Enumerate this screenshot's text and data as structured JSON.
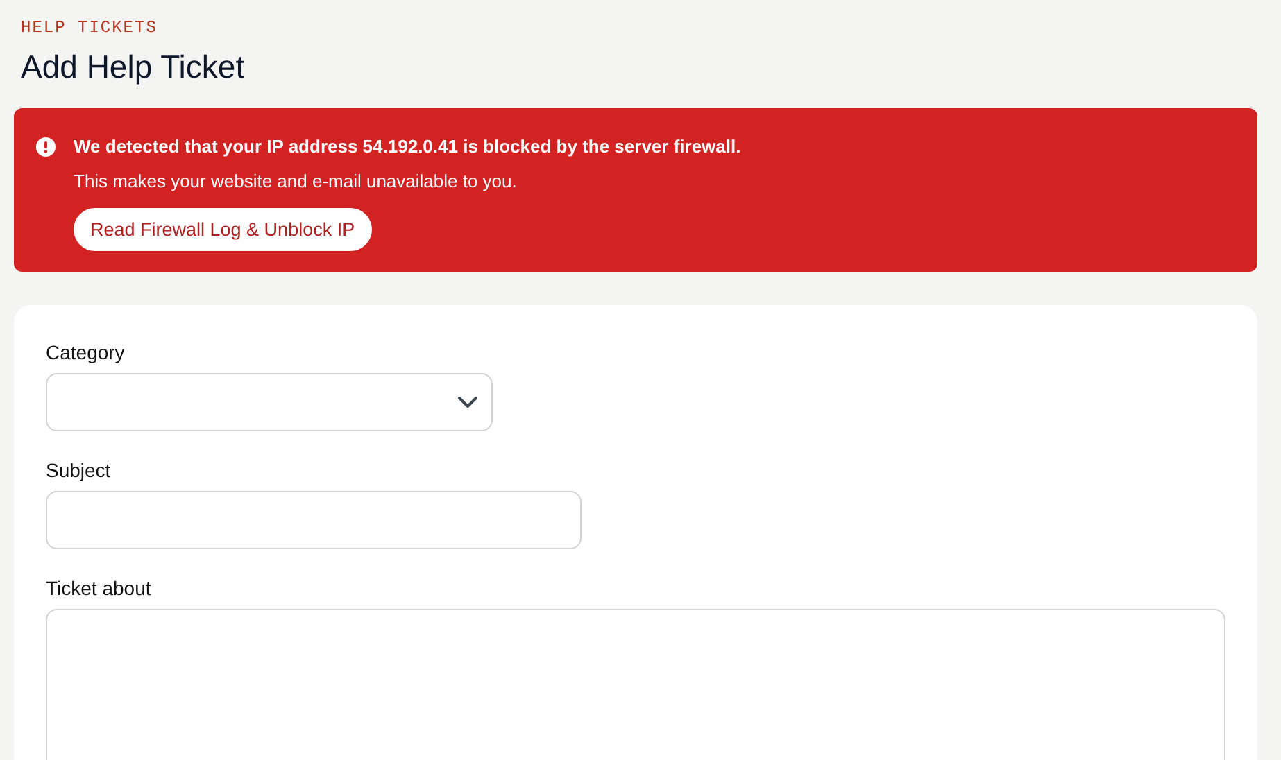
{
  "breadcrumb": "HELP TICKETS",
  "title": "Add Help Ticket",
  "alert": {
    "message": "We detected that your IP address 54.192.0.41 is blocked by the server firewall.",
    "detail": "This makes your website and e-mail unavailable to you.",
    "button": "Read Firewall Log & Unblock IP"
  },
  "form": {
    "fields": [
      {
        "kind": "select",
        "label": "Category"
      },
      {
        "kind": "text",
        "label": "Subject"
      },
      {
        "kind": "textarea",
        "label": "Ticket about"
      }
    ]
  }
}
